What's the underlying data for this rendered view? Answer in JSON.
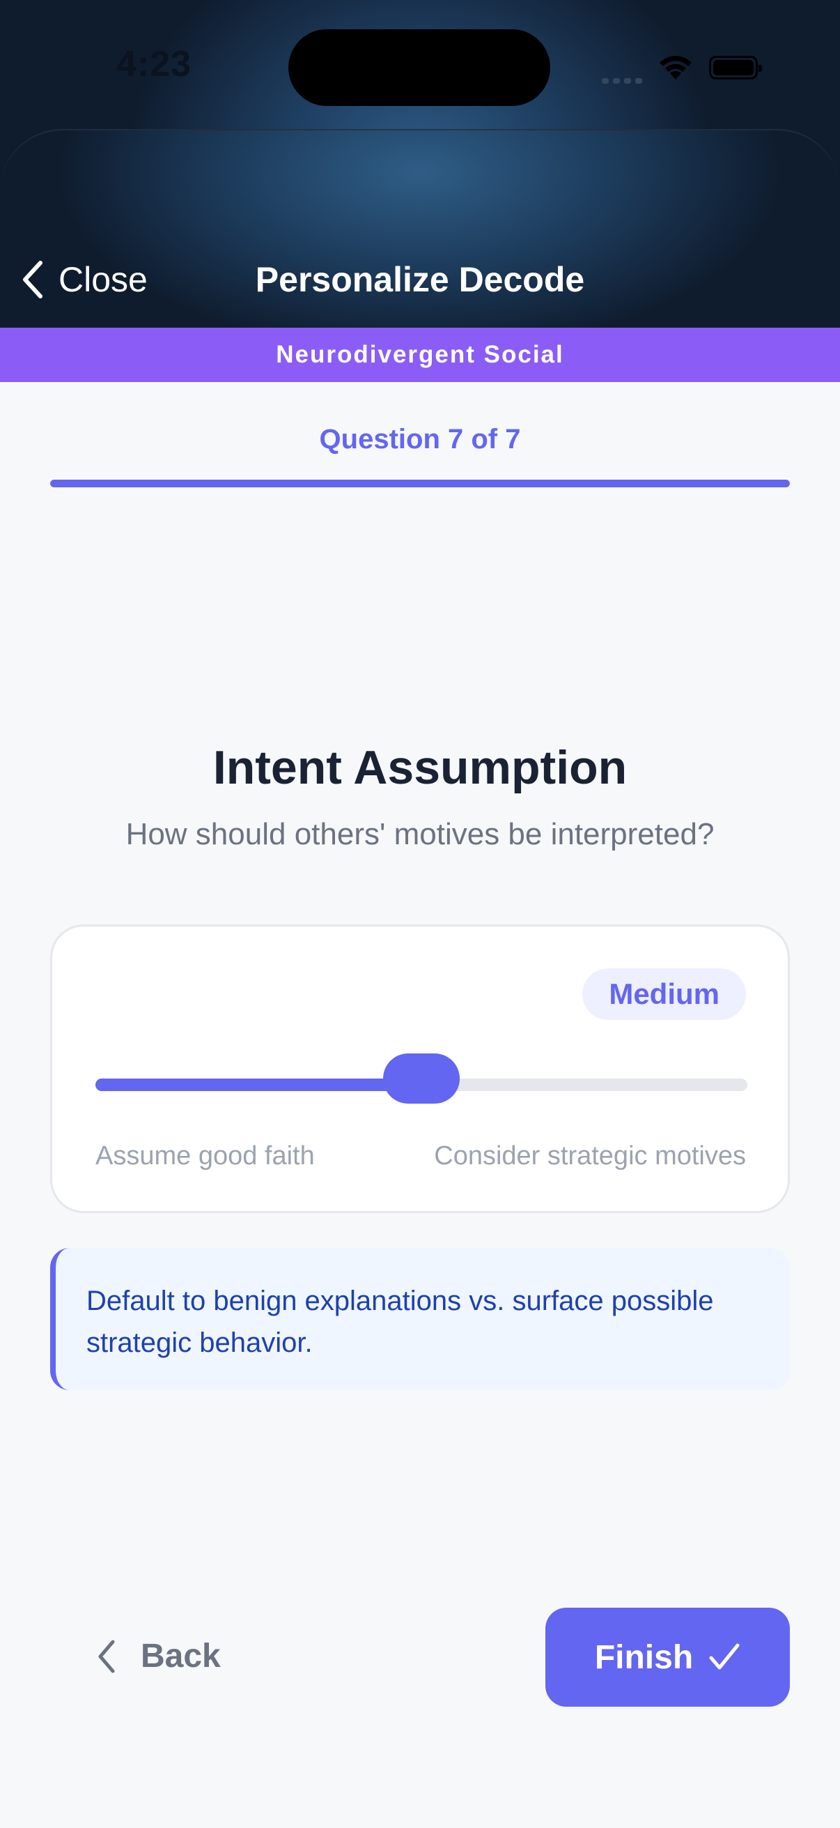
{
  "status_bar": {
    "time": "4:23"
  },
  "header": {
    "close_label": "Close",
    "title": "Personalize Decode"
  },
  "banner": {
    "label": "Neurodivergent Social"
  },
  "progress": {
    "label": "Question 7 of 7",
    "current": 7,
    "total": 7,
    "fraction": 1.0,
    "accent_color": "#6366f1"
  },
  "question": {
    "title": "Intent Assumption",
    "subtitle": "How should others' motives be interpreted?",
    "slider": {
      "value_label": "Medium",
      "value_fraction": 0.5,
      "min_label": "Assume good faith",
      "max_label": "Consider strategic motives"
    },
    "description": "Default to benign explanations vs. surface possible strategic behavior."
  },
  "footer": {
    "back_label": "Back",
    "finish_label": "Finish",
    "finish_icon": "checkmark-icon"
  },
  "colors": {
    "accent": "#6366f1",
    "banner": "#8b5cf6",
    "header_bg": "#1c3a5a",
    "page_bg": "#f7f8fa"
  }
}
